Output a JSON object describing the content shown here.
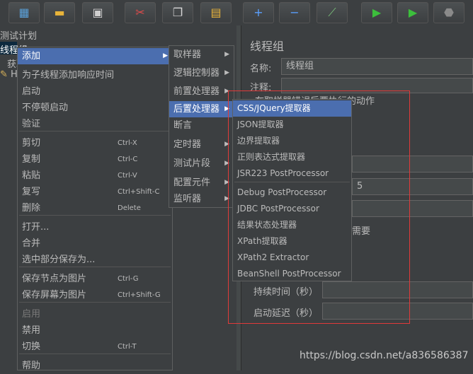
{
  "toolbar": {
    "buttons": [
      {
        "name": "templates-icon",
        "glyph": "▦",
        "color": "#5aa0d8"
      },
      {
        "name": "open-icon",
        "glyph": "▬",
        "color": "#e8b43a"
      },
      {
        "name": "save-icon",
        "glyph": "▣",
        "color": "#cfcfcf"
      },
      {
        "name": "cut-icon",
        "glyph": "✂",
        "color": "#e04a4a"
      },
      {
        "name": "copy-icon",
        "glyph": "❐",
        "color": "#d8d8d8"
      },
      {
        "name": "paste-icon",
        "glyph": "▤",
        "color": "#e8b43a"
      },
      {
        "name": "expand-icon",
        "glyph": "+",
        "color": "#5aa0ff"
      },
      {
        "name": "collapse-icon",
        "glyph": "−",
        "color": "#5aa0ff"
      },
      {
        "name": "toggle-icon",
        "glyph": "⟋",
        "color": "#7ac07a"
      },
      {
        "name": "start-icon",
        "glyph": "▶",
        "color": "#3cbf3c"
      },
      {
        "name": "start-no-pause-icon",
        "glyph": "▶",
        "color": "#3cbf3c"
      },
      {
        "name": "stop-icon",
        "glyph": "⬣",
        "color": "#8a8a8a"
      }
    ]
  },
  "tree": {
    "test_plan": "测试计划",
    "thread_group": "线程组",
    "child": "获取",
    "child2": "H"
  },
  "context_menu": {
    "items": [
      {
        "label": "添加",
        "accel": "",
        "sub": true,
        "selected": true
      },
      {
        "label": "为子线程添加响应时间",
        "accel": ""
      },
      {
        "label": "启动",
        "accel": ""
      },
      {
        "label": "不停顿启动",
        "accel": ""
      },
      {
        "label": "验证",
        "accel": ""
      },
      {
        "label": "剪切",
        "accel": "Ctrl-X"
      },
      {
        "label": "复制",
        "accel": "Ctrl-C"
      },
      {
        "label": "粘贴",
        "accel": "Ctrl-V"
      },
      {
        "label": "复写",
        "accel": "Ctrl+Shift-C"
      },
      {
        "label": "删除",
        "accel": "Delete"
      },
      {
        "label": "打开...",
        "accel": ""
      },
      {
        "label": "合并",
        "accel": ""
      },
      {
        "label": "选中部分保存为...",
        "accel": ""
      },
      {
        "label": "保存节点为图片",
        "accel": "Ctrl-G"
      },
      {
        "label": "保存屏幕为图片",
        "accel": "Ctrl+Shift-G"
      },
      {
        "label": "启用",
        "accel": "",
        "disabled": true
      },
      {
        "label": "禁用",
        "accel": ""
      },
      {
        "label": "切换",
        "accel": "Ctrl-T"
      },
      {
        "label": "帮助",
        "accel": ""
      }
    ]
  },
  "add_menu": {
    "items": [
      {
        "label": "取样器"
      },
      {
        "label": "逻辑控制器"
      },
      {
        "label": "前置处理器"
      },
      {
        "label": "后置处理器",
        "selected": true
      },
      {
        "label": "断言"
      },
      {
        "label": "定时器"
      },
      {
        "label": "测试片段"
      },
      {
        "label": "配置元件"
      },
      {
        "label": "监听器"
      }
    ]
  },
  "post_menu": {
    "items": [
      {
        "label": "CSS/JQuery提取器",
        "selected": true
      },
      {
        "label": "JSON提取器"
      },
      {
        "label": "边界提取器"
      },
      {
        "label": "正则表达式提取器"
      },
      {
        "label": "JSR223 PostProcessor"
      },
      {
        "label": "Debug PostProcessor"
      },
      {
        "label": "JDBC PostProcessor"
      },
      {
        "label": "结果状态处理器"
      },
      {
        "label": "XPath提取器"
      },
      {
        "label": "XPath2 Extractor"
      },
      {
        "label": "BeanShell PostProcessor"
      }
    ]
  },
  "panel": {
    "title": "线程组",
    "name_label": "名称:",
    "name_value": "线程组",
    "comment_label": "注释:",
    "error_action": "在取样器错误后要执行的动作",
    "value_5": "5",
    "need": "需要",
    "duration_label": "持续时间（秒）",
    "delay_label": "启动延迟（秒）"
  },
  "watermark": "https://blog.csdn.net/a836586387"
}
